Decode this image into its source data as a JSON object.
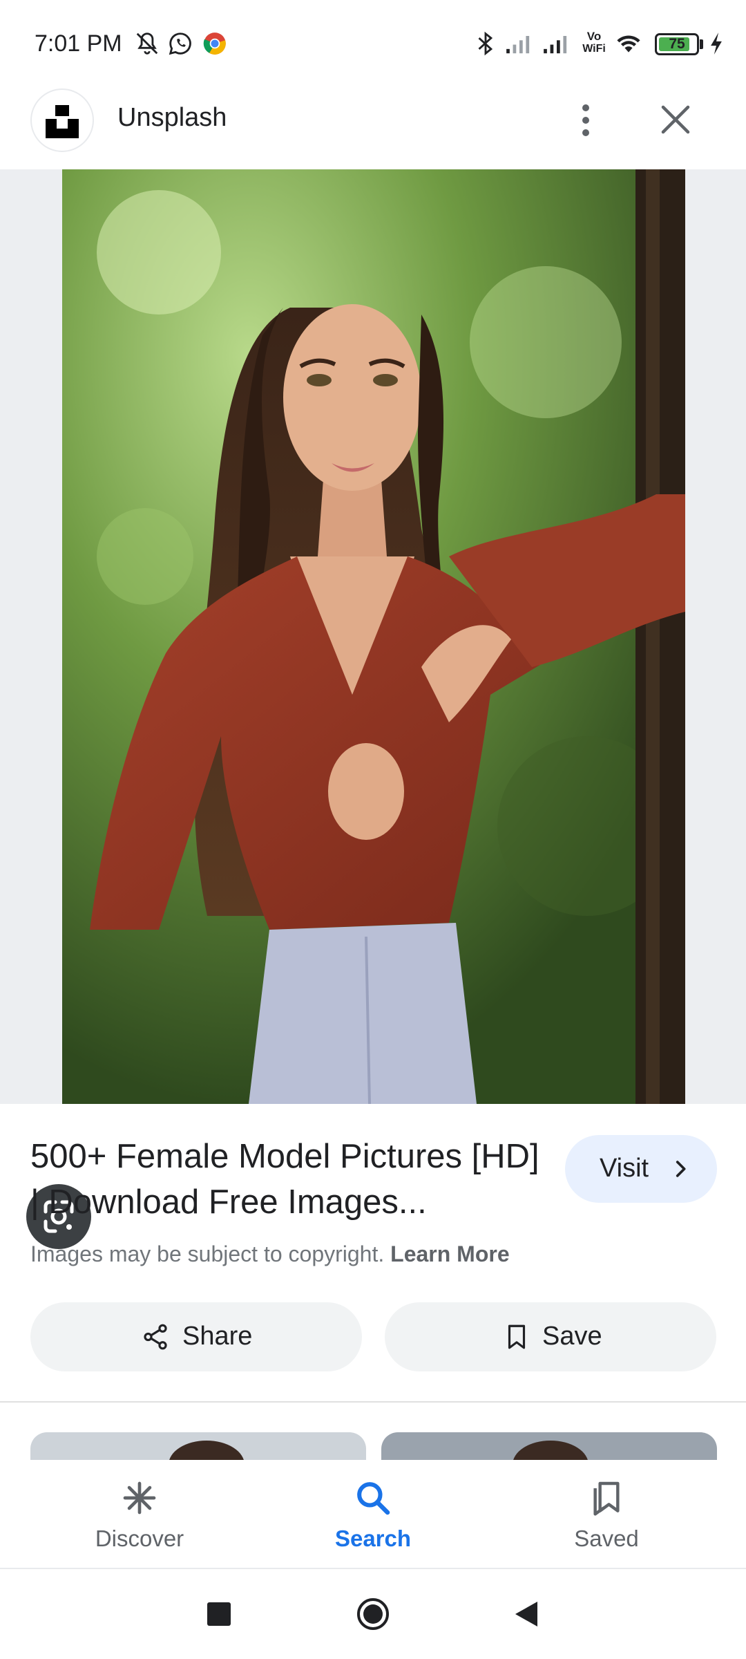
{
  "status_bar": {
    "time": "7:01 PM",
    "battery_percent": "75",
    "icons": [
      "mute-bell-icon",
      "whatsapp-icon",
      "chrome-icon",
      "bluetooth-icon",
      "signal-icon",
      "signal-icon",
      "vowifi-icon",
      "wifi-icon",
      "battery-icon",
      "charging-icon"
    ],
    "vowifi_top": "Vo",
    "vowifi_bottom": "WiFi"
  },
  "header": {
    "site_name": "Unsplash"
  },
  "result": {
    "title": "500+ Female Model Pictures [HD] | Download Free Images...",
    "visit_label": "Visit",
    "copyright_text": "Images may be subject to copyright.",
    "learn_more": "Learn More",
    "share_label": "Share",
    "save_label": "Save"
  },
  "bottom_nav": {
    "items": [
      {
        "label": "Discover",
        "icon": "discover-icon",
        "active": false
      },
      {
        "label": "Search",
        "icon": "search-icon",
        "active": true
      },
      {
        "label": "Saved",
        "icon": "saved-icon",
        "active": false
      }
    ]
  },
  "colors": {
    "accent": "#1a73e8",
    "visit_bg": "#e8f0fe",
    "button_bg": "#f1f3f4",
    "text_primary": "#202124",
    "text_secondary": "#70757a"
  }
}
